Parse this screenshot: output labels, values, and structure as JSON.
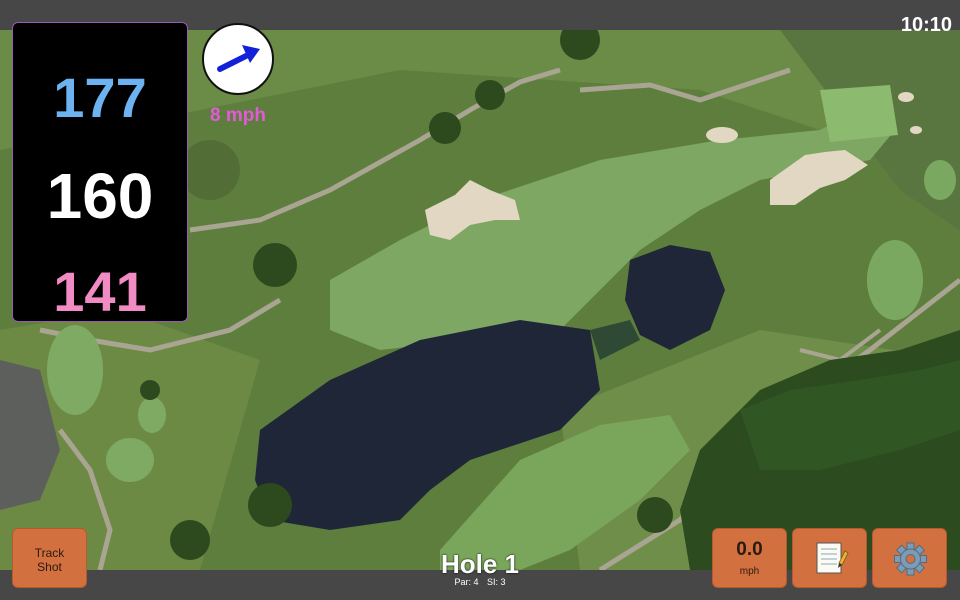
{
  "status_bar": {
    "time": "10:10"
  },
  "distances": {
    "back": "177",
    "middle": "160",
    "front": "141"
  },
  "wind": {
    "speed_label": "8 mph",
    "icon": "wind-arrow-icon",
    "direction": "north-east"
  },
  "buttons": {
    "track_shot_label": "Track Shot",
    "speed_value": "0.0",
    "speed_unit": "mph",
    "notes_icon": "notepad-icon",
    "settings_icon": "gear-icon"
  },
  "hole": {
    "title": "Hole 1",
    "par_label": "Par: 4",
    "si_label": "SI: 3"
  },
  "colors": {
    "back_distance": "#6db3f2",
    "middle_distance": "#ffffff",
    "front_distance": "#f08bc3",
    "wind_text": "#e35ad8",
    "button_fill": "#d2703f"
  }
}
